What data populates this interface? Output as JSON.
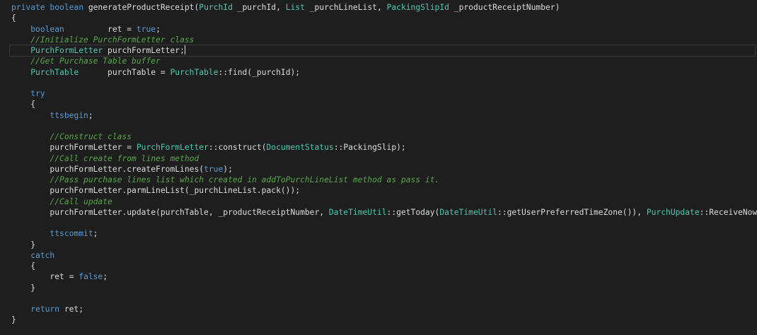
{
  "editor": {
    "current_line": 4,
    "lines": [
      [
        [
          "kw",
          "private boolean"
        ],
        [
          "tx",
          " generateProductReceipt("
        ],
        [
          "ty",
          "PurchId"
        ],
        [
          "tx",
          " _purchId, "
        ],
        [
          "ty",
          "List"
        ],
        [
          "tx",
          " _purchLineList, "
        ],
        [
          "ty",
          "PackingSlipId"
        ],
        [
          "tx",
          " _productReceiptNumber)"
        ]
      ],
      [
        [
          "tx",
          "{"
        ]
      ],
      [
        [
          "tx",
          "    "
        ],
        [
          "kw",
          "boolean"
        ],
        [
          "tx",
          "         ret = "
        ],
        [
          "kw",
          "true"
        ],
        [
          "tx",
          ";"
        ]
      ],
      [
        [
          "tx",
          "    "
        ],
        [
          "cm",
          "//Initialize PurchFormLetter class"
        ]
      ],
      [
        [
          "tx",
          "    "
        ],
        [
          "ty",
          "PurchFormLetter"
        ],
        [
          "tx",
          " purchFormLetter;"
        ],
        [
          "caret",
          ""
        ]
      ],
      [
        [
          "tx",
          "    "
        ],
        [
          "cm",
          "//Get Purchase Table buffer"
        ]
      ],
      [
        [
          "tx",
          "    "
        ],
        [
          "ty",
          "PurchTable"
        ],
        [
          "tx",
          "      purchTable = "
        ],
        [
          "ty",
          "PurchTable"
        ],
        [
          "tx",
          "::find(_purchId);"
        ]
      ],
      [],
      [
        [
          "tx",
          "    "
        ],
        [
          "kw",
          "try"
        ]
      ],
      [
        [
          "tx",
          "    {"
        ]
      ],
      [
        [
          "tx",
          "        "
        ],
        [
          "kw",
          "ttsbegin"
        ],
        [
          "tx",
          ";"
        ]
      ],
      [],
      [
        [
          "tx",
          "        "
        ],
        [
          "cm",
          "//Construct class"
        ]
      ],
      [
        [
          "tx",
          "        purchFormLetter = "
        ],
        [
          "ty",
          "PurchFormLetter"
        ],
        [
          "tx",
          "::construct("
        ],
        [
          "ty",
          "DocumentStatus"
        ],
        [
          "tx",
          "::PackingSlip);"
        ]
      ],
      [
        [
          "tx",
          "        "
        ],
        [
          "cm",
          "//Call create from lines method"
        ]
      ],
      [
        [
          "tx",
          "        purchFormLetter.createFromLines("
        ],
        [
          "kw",
          "true"
        ],
        [
          "tx",
          ");"
        ]
      ],
      [
        [
          "tx",
          "        "
        ],
        [
          "cm",
          "//Pass purchase lines list which created in addToPurchLineList method as pass it."
        ]
      ],
      [
        [
          "tx",
          "        purchFormLetter.parmLineList(_purchLineList.pack());"
        ]
      ],
      [
        [
          "tx",
          "        "
        ],
        [
          "cm",
          "//Call update"
        ]
      ],
      [
        [
          "tx",
          "        purchFormLetter.update(purchTable, _productReceiptNumber, "
        ],
        [
          "ty",
          "DateTimeUtil"
        ],
        [
          "tx",
          "::getToday("
        ],
        [
          "ty",
          "DateTimeUtil"
        ],
        [
          "tx",
          "::getUserPreferredTimeZone()), "
        ],
        [
          "ty",
          "PurchUpdate"
        ],
        [
          "tx",
          "::ReceiveNow);"
        ]
      ],
      [],
      [
        [
          "tx",
          "        "
        ],
        [
          "kw",
          "ttscommit"
        ],
        [
          "tx",
          ";"
        ]
      ],
      [
        [
          "tx",
          "    }"
        ]
      ],
      [
        [
          "tx",
          "    "
        ],
        [
          "kw",
          "catch"
        ]
      ],
      [
        [
          "tx",
          "    {"
        ]
      ],
      [
        [
          "tx",
          "        ret = "
        ],
        [
          "kw",
          "false"
        ],
        [
          "tx",
          ";"
        ]
      ],
      [
        [
          "tx",
          "    }"
        ]
      ],
      [],
      [
        [
          "tx",
          "    "
        ],
        [
          "kw",
          "return"
        ],
        [
          "tx",
          " ret;"
        ]
      ],
      [
        [
          "tx",
          "}"
        ]
      ]
    ]
  }
}
